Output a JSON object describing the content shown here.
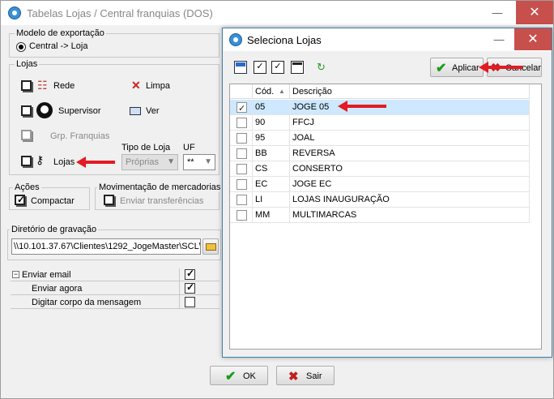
{
  "main": {
    "title": "Tabelas Lojas / Central franquias (DOS)",
    "export_group_label": "Modelo de exportação",
    "export_option": "Central -> Loja",
    "lojas_group_label": "Lojas",
    "items": {
      "rede": "Rede",
      "limpa": "Limpa",
      "supervisor": "Supervisor",
      "ver": "Ver",
      "grp_franquias": "Grp. Franquias",
      "lojas": "Lojas"
    },
    "tipo_loja_label": "Tipo de Loja",
    "tipo_loja_value": "Próprias",
    "uf_label": "UF",
    "uf_value": "**",
    "acoes_label": "Ações",
    "compactar": "Compactar",
    "mov_label": "Movimentação de mercadorias",
    "enviar_transferencias": "Enviar transferências",
    "diretorio_label": "Diretório de gravação",
    "diretorio_value": "\\\\10.101.37.67\\Clientes\\1292_JogeMaster\\SCL\\",
    "email_rows": [
      {
        "label": "Enviar email",
        "checked": true
      },
      {
        "label": "Enviar agora",
        "checked": true
      },
      {
        "label": "Digitar corpo da mensagem",
        "checked": false
      }
    ],
    "ok_label": "OK",
    "sair_label": "Sair"
  },
  "dialog": {
    "title": "Seleciona Lojas",
    "aplicar_label": "Aplicar",
    "cancelar_label": "Cancelar",
    "columns": [
      "Cód.",
      "Descrição"
    ],
    "rows": [
      {
        "cod": "05",
        "desc": "JOGE 05",
        "checked": true,
        "selected": true
      },
      {
        "cod": "90",
        "desc": "FFCJ",
        "checked": false,
        "selected": false
      },
      {
        "cod": "95",
        "desc": "JOAL",
        "checked": false,
        "selected": false
      },
      {
        "cod": "BB",
        "desc": "REVERSA",
        "checked": false,
        "selected": false
      },
      {
        "cod": "CS",
        "desc": "CONSERTO",
        "checked": false,
        "selected": false
      },
      {
        "cod": "EC",
        "desc": "JOGE EC",
        "checked": false,
        "selected": false
      },
      {
        "cod": "LI",
        "desc": "LOJAS INAUGURAÇÃO",
        "checked": false,
        "selected": false
      },
      {
        "cod": "MM",
        "desc": "MULTIMARCAS",
        "checked": false,
        "selected": false
      }
    ]
  },
  "colors": {
    "accent": "#3c7fb1",
    "close": "#c7504d",
    "arrow": "#e31b23",
    "selection": "#cde8ff"
  }
}
